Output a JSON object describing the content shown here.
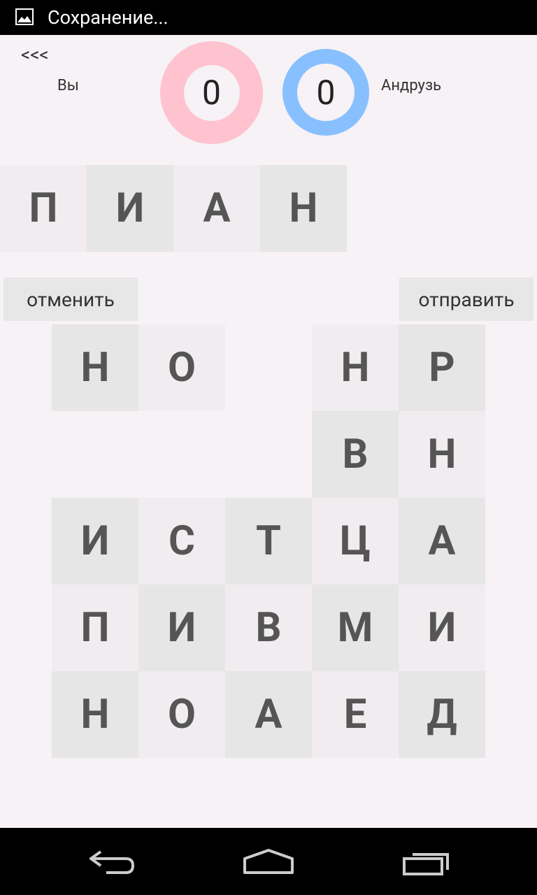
{
  "status_bar": {
    "title": "Сохранение...",
    "icon": "image-icon"
  },
  "header": {
    "back_label": "<<<",
    "player_name": "Вы",
    "opponent_name": "Андрузь",
    "player_score": "0",
    "opponent_score": "0"
  },
  "word": [
    "П",
    "И",
    "А",
    "Н"
  ],
  "buttons": {
    "cancel": "отменить",
    "send": "отправить"
  },
  "board": [
    [
      "Н",
      "О",
      "",
      "Н",
      "Р"
    ],
    [
      "",
      "",
      "",
      "В",
      "Н"
    ],
    [
      "И",
      "С",
      "Т",
      "Ц",
      "А"
    ],
    [
      "П",
      "И",
      "В",
      "М",
      "И"
    ],
    [
      "Н",
      "О",
      "А",
      "Е",
      "Д"
    ]
  ],
  "colors": {
    "player_ring": "#ffc2cf",
    "opponent_ring": "#88c0ff",
    "background": "#f6f2f6"
  },
  "nav": {
    "icons": [
      "back-icon",
      "home-icon",
      "recent-apps-icon"
    ]
  }
}
